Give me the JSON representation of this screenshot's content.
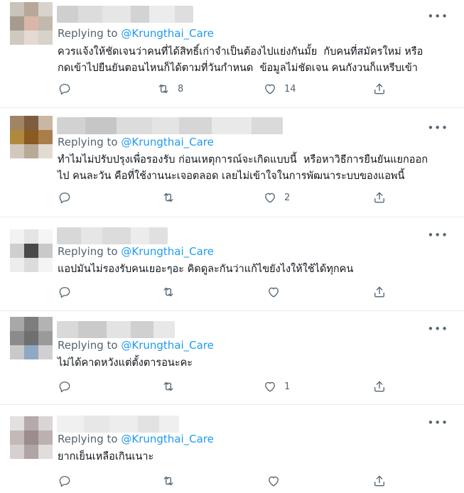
{
  "replies": [
    {
      "replying_prefix": "Replying to",
      "handle": "@Krungthai_Care",
      "text": "ควรแจ้งให้ชัดเจนว่าคนที่ได้สิทธิ์เก่าจำเป็นต้องไปแย่งกันมั้ย  กับคนที่สมัครใหม่ หรือ\nกดเข้าไปยืนยันตอนไหนก็ได้ตามที่วันกำหนด  ข้อมูลไม่ชัดเจน คนกังวนก็แหรีบเข้า",
      "reply_count": "",
      "retweet_count": "8",
      "like_count": "14",
      "avatar_colors": [
        "#c8c3bb",
        "#b9a79a",
        "#d8d4cc",
        "#a59b8f",
        "#d9b7a8",
        "#c2b9ad",
        "#cfc9c0",
        "#e4dad3",
        "#d7d2ca"
      ]
    },
    {
      "replying_prefix": "Replying to",
      "handle": "@Krungthai_Care",
      "text": "ทำไมไม่ปรับปรุงเพื่อรองรับ ก่อนเหตุการณ์จะเกิดแบบนี้  หรือหาวิธีการยืนยันแยกออก\nไป คนละวัน คือที่ใช้งานนะเจอตลอด เลยไม่เข้าใจในการพัฒนาระบบของแอพนี้",
      "reply_count": "",
      "retweet_count": "",
      "like_count": "2",
      "avatar_colors": [
        "#a08466",
        "#7c5d3e",
        "#c9b7a3",
        "#b08a3c",
        "#8a5a22",
        "#a97e4a",
        "#d2c8bd",
        "#b9aa97",
        "#e2dbd2"
      ]
    },
    {
      "replying_prefix": "Replying to",
      "handle": "@Krungthai_Care",
      "text": "แอปมันไม่รองรับคนเยอะๆอะ คิดดูละกันว่าแก้ไขยังไงให้ใช้ได้ทุกคน",
      "reply_count": "",
      "retweet_count": "",
      "like_count": "",
      "avatar_colors": [
        "#f2f2f2",
        "#e4e4e4",
        "#f5f5f5",
        "#cfcfcf",
        "#4a4a4a",
        "#c9c9c9",
        "#ededed",
        "#dcdcdc",
        "#f4f4f4"
      ]
    },
    {
      "replying_prefix": "Replying to",
      "handle": "@Krungthai_Care",
      "text": "ไม่ได้คาดหวังแต่ตั้งตารอนะคะ",
      "reply_count": "",
      "retweet_count": "",
      "like_count": "1",
      "avatar_colors": [
        "#a8a8a8",
        "#7d7d7d",
        "#b3b3b3",
        "#8b8b8b",
        "#6f6f6f",
        "#9a9a9a",
        "#c9c9c9",
        "#8fa8c4",
        "#d0d0d0"
      ]
    },
    {
      "replying_prefix": "Replying to",
      "handle": "@Krungthai_Care",
      "text": "ยากเย็นเหลือเกินเนาะ",
      "reply_count": "",
      "retweet_count": "",
      "like_count": "",
      "avatar_colors": [
        "#e3e0e0",
        "#b5aaa9",
        "#d9d5d5",
        "#c2b9b8",
        "#9c8c8b",
        "#bcb1b0",
        "#d6d1d0",
        "#b0a5a4",
        "#e1dddc"
      ]
    }
  ]
}
